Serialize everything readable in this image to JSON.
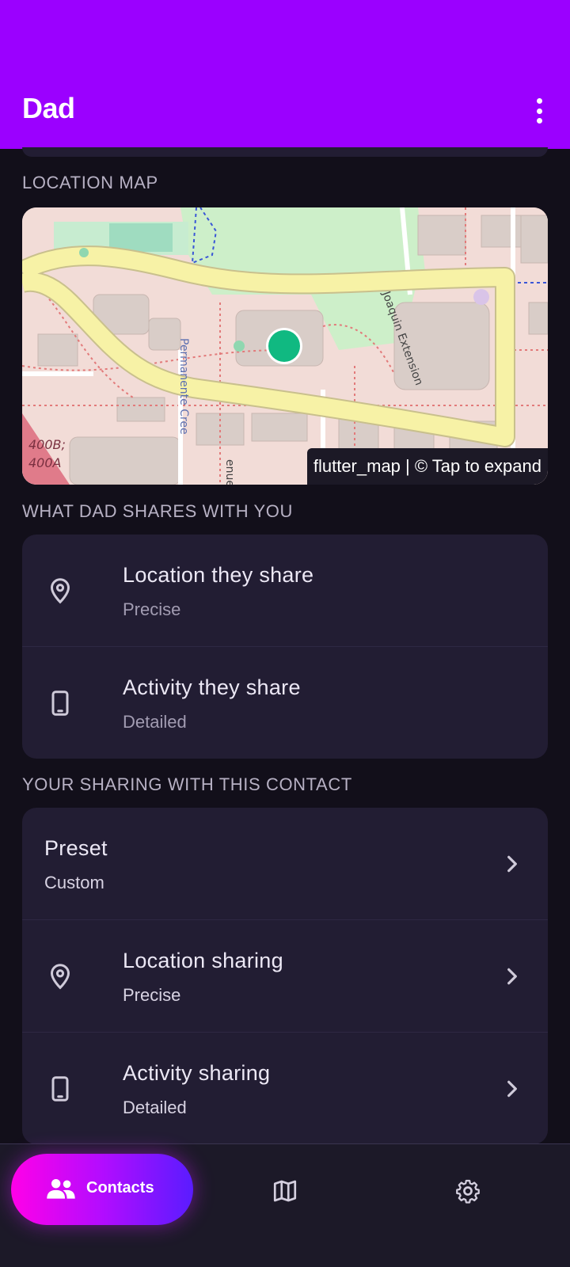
{
  "app": {
    "title": "Dad"
  },
  "sections": {
    "location_map": "LOCATION MAP",
    "shares_with_you": "WHAT DAD SHARES WITH YOU",
    "your_sharing": "YOUR SHARING WITH THIS CONTACT"
  },
  "map": {
    "attribution": "flutter_map | © Tap to expand",
    "labels": {
      "street_left": "Permanente Cree",
      "street_right": "Joaquin Extension",
      "building": "400B;",
      "building2": "400A",
      "street_bottom": "enue"
    },
    "marker_color": "#10b981"
  },
  "shares": [
    {
      "title": "Location they share",
      "value": "Precise",
      "icon": "location-pin-icon"
    },
    {
      "title": "Activity they share",
      "value": "Detailed",
      "icon": "phone-icon"
    }
  ],
  "sharing": [
    {
      "title": "Preset",
      "value": "Custom"
    },
    {
      "title": "Location sharing",
      "value": "Precise",
      "icon": "location-pin-icon"
    },
    {
      "title": "Activity sharing",
      "value": "Detailed",
      "icon": "phone-icon"
    }
  ],
  "nav": {
    "contacts": "Contacts",
    "map_icon": "map-icon",
    "settings_icon": "gear-icon"
  },
  "colors": {
    "appbar": "#9b00ff",
    "background": "#120f1a",
    "card": "#221d33"
  }
}
